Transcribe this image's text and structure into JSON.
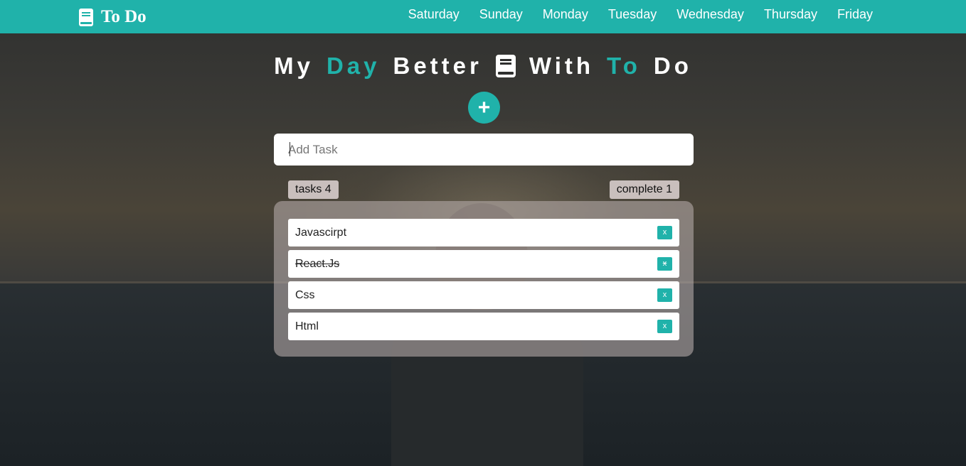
{
  "navbar": {
    "brand": "To Do",
    "brand_icon": "book-icon",
    "days": [
      "Saturday",
      "Sunday",
      "Monday",
      "Tuesday",
      "Wednesday",
      "Thursday",
      "Friday"
    ]
  },
  "hero": {
    "word1": "My",
    "word2": "Day",
    "word3": "Better",
    "icon": "book-icon",
    "word4": "With",
    "word5": "To",
    "word6": "Do"
  },
  "add_button": {
    "label": "+"
  },
  "input": {
    "placeholder": "Add Task",
    "value": ""
  },
  "stats": {
    "tasks_label": "tasks 4",
    "complete_label": "complete 1"
  },
  "tasks": [
    {
      "label": "Javascirpt",
      "done": false,
      "delete_label": "x"
    },
    {
      "label": "React.Js",
      "done": true,
      "delete_label": "x"
    },
    {
      "label": "Css",
      "done": false,
      "delete_label": "x"
    },
    {
      "label": "Html",
      "done": false,
      "delete_label": "x"
    }
  ],
  "colors": {
    "accent": "#20b2aa",
    "badge": "#c9bfbd",
    "panel": "rgba(180,170,168,0.6)"
  }
}
